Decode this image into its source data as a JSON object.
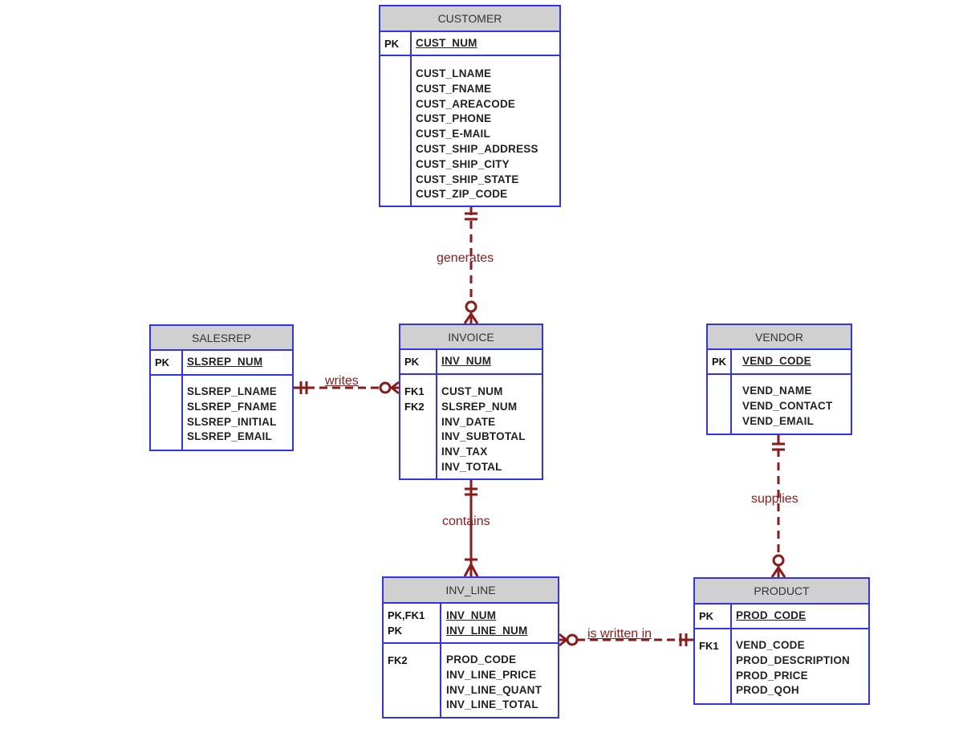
{
  "diagram": {
    "type": "crow's foot ERD",
    "colors": {
      "entity_border": "#3333ee",
      "entity_header": "#d0d0d0",
      "relationship": "#8b1a1a"
    },
    "entities": {
      "customer": {
        "name": "CUSTOMER",
        "pk_keys": [
          "PK"
        ],
        "pk_attrs": [
          "CUST_NUM"
        ],
        "keys": [],
        "attrs": [
          "CUST_LNAME",
          "CUST_FNAME",
          "CUST_AREACODE",
          "CUST_PHONE",
          "CUST_E-MAIL",
          "CUST_SHIP_ADDRESS",
          "CUST_SHIP_CITY",
          "CUST_SHIP_STATE",
          "CUST_ZIP_CODE"
        ]
      },
      "salesrep": {
        "name": "SALESREP",
        "pk_keys": [
          "PK"
        ],
        "pk_attrs": [
          "SLSREP_NUM"
        ],
        "keys": [],
        "attrs": [
          "SLSREP_LNAME",
          "SLSREP_FNAME",
          "SLSREP_INITIAL",
          "SLSREP_EMAIL"
        ]
      },
      "invoice": {
        "name": "INVOICE",
        "pk_keys": [
          "PK"
        ],
        "pk_attrs": [
          "INV_NUM"
        ],
        "keys": [
          "FK1",
          "FK2"
        ],
        "attrs": [
          "CUST_NUM",
          "SLSREP_NUM",
          "INV_DATE",
          "INV_SUBTOTAL",
          "INV_TAX",
          "INV_TOTAL"
        ]
      },
      "vendor": {
        "name": "VENDOR",
        "pk_keys": [
          "PK"
        ],
        "pk_attrs": [
          "VEND_CODE"
        ],
        "keys": [],
        "attrs": [
          "VEND_NAME",
          "VEND_CONTACT",
          "VEND_EMAIL"
        ]
      },
      "inv_line": {
        "name": "INV_LINE",
        "pk_keys": [
          "PK,FK1",
          "PK"
        ],
        "pk_attrs": [
          "INV_NUM",
          "INV_LINE_NUM"
        ],
        "keys": [
          "FK2"
        ],
        "attrs": [
          "PROD_CODE",
          "INV_LINE_PRICE",
          "INV_LINE_QUANT",
          "INV_LINE_TOTAL"
        ]
      },
      "product": {
        "name": "PRODUCT",
        "pk_keys": [
          "PK"
        ],
        "pk_attrs": [
          "PROD_CODE"
        ],
        "keys": [
          "FK1"
        ],
        "attrs": [
          "VEND_CODE",
          "PROD_DESCRIPTION",
          "PROD_PRICE",
          "PROD_QOH"
        ]
      }
    },
    "relationships": {
      "generates": {
        "label": "generates",
        "from": "CUSTOMER",
        "to": "INVOICE",
        "from_cardinality": "one and only one",
        "to_cardinality": "zero or many",
        "style": "dashed"
      },
      "writes": {
        "label": "writes",
        "from": "SALESREP",
        "to": "INVOICE",
        "from_cardinality": "one and only one",
        "to_cardinality": "zero or many",
        "style": "dashed"
      },
      "contains": {
        "label": "contains",
        "from": "INVOICE",
        "to": "INV_LINE",
        "from_cardinality": "one and only one",
        "to_cardinality": "one or many",
        "style": "solid"
      },
      "supplies": {
        "label": "supplies",
        "from": "VENDOR",
        "to": "PRODUCT",
        "from_cardinality": "one and only one",
        "to_cardinality": "zero or many",
        "style": "dashed"
      },
      "is_written_in": {
        "label": "is written in",
        "from": "PRODUCT",
        "to": "INV_LINE",
        "from_cardinality": "one and only one",
        "to_cardinality": "zero or many",
        "style": "dashed"
      }
    }
  }
}
